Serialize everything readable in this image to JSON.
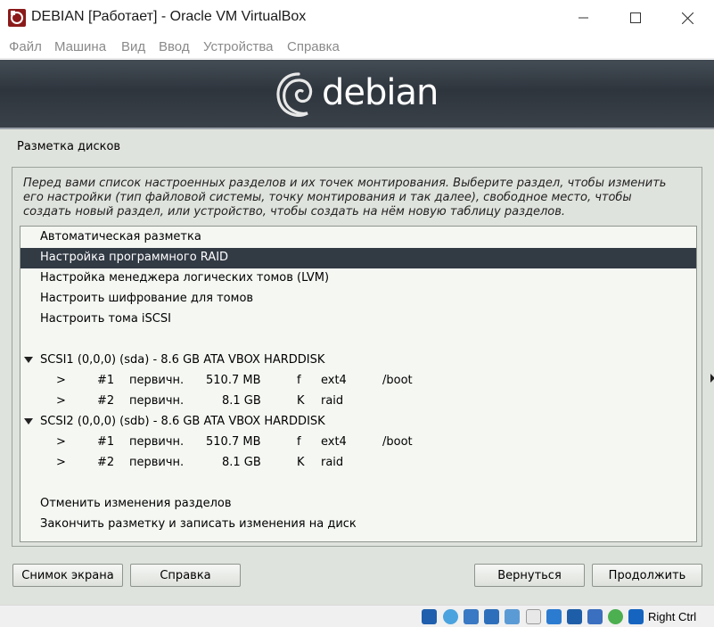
{
  "window": {
    "title": "DEBIAN [Работает] - Oracle VM VirtualBox",
    "menu": [
      "Файл",
      "Машина",
      "Вид",
      "Ввод",
      "Устройства",
      "Справка"
    ]
  },
  "installer": {
    "logo_text": "debian",
    "section_title": "Разметка дисков",
    "intro": "Перед вами список настроенных разделов и их точек монтирования. Выберите раздел, чтобы изменить его настройки (тип файловой системы, точку монтирования и так далее), свободное место, чтобы создать новый раздел, или устройство, чтобы создать на нём новую таблицу разделов.",
    "actions": [
      "Автоматическая разметка",
      "Настройка программного RAID",
      "Настройка менеджера логических томов (LVM)",
      "Настроить шифрование для томов",
      "Настроить тома iSCSI"
    ],
    "selected_action_index": 1,
    "disks": [
      {
        "label": "SCSI1 (0,0,0) (sda) - 8.6 GB ATA VBOX HARDDISK",
        "partitions": [
          {
            "arrow": ">",
            "num": "#1",
            "type": "первичн.",
            "size": "510.7 MB",
            "flag": "f",
            "fs": "ext4",
            "mount": "/boot"
          },
          {
            "arrow": ">",
            "num": "#2",
            "type": "первичн.",
            "size": "8.1 GB",
            "flag": "K",
            "fs": "raid",
            "mount": ""
          }
        ]
      },
      {
        "label": "SCSI2 (0,0,0) (sdb) - 8.6 GB ATA VBOX HARDDISK",
        "partitions": [
          {
            "arrow": ">",
            "num": "#1",
            "type": "первичн.",
            "size": "510.7 MB",
            "flag": "f",
            "fs": "ext4",
            "mount": "/boot"
          },
          {
            "arrow": ">",
            "num": "#2",
            "type": "первичн.",
            "size": "8.1 GB",
            "flag": "K",
            "fs": "raid",
            "mount": ""
          }
        ]
      }
    ],
    "footer_actions": [
      "Отменить изменения разделов",
      "Закончить разметку и записать изменения на диск"
    ],
    "buttons": {
      "screenshot": "Снимок экрана",
      "help": "Справка",
      "back": "Вернуться",
      "continue": "Продолжить"
    }
  },
  "statusbar": {
    "host_key": "Right Ctrl",
    "icons": [
      "hard-disk-icon",
      "optical-drive-icon",
      "audio-icon",
      "network-icon",
      "usb-icon",
      "shared-folders-icon",
      "display-icon",
      "screen-recording-icon",
      "virtualization-icon",
      "mouse-integration-icon",
      "keyboard-capture-icon"
    ]
  },
  "colors": {
    "selection": "#323a44",
    "banner": "#2e353d",
    "background": "#dfe3dd",
    "list_background": "#f4f7f2"
  }
}
